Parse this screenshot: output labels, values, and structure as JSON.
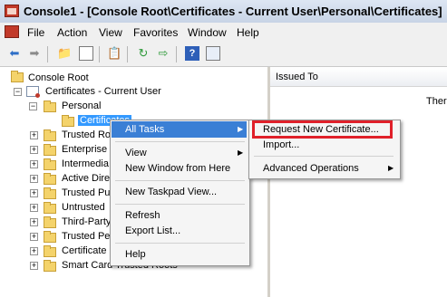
{
  "window": {
    "title": "Console1 - [Console Root\\Certificates - Current User\\Personal\\Certificates]"
  },
  "menubar": {
    "items": [
      "File",
      "Action",
      "View",
      "Favorites",
      "Window",
      "Help"
    ]
  },
  "toolbar": {
    "icons": [
      "back-arrow-icon",
      "forward-arrow-icon",
      "up-folder-icon",
      "show-hide-tree-icon",
      "clipboard-icon",
      "refresh-icon",
      "export-icon",
      "help-icon",
      "properties-icon"
    ]
  },
  "tree": {
    "root": "Console Root",
    "store": "Certificates - Current User",
    "personal": "Personal",
    "certificates": "Certificates",
    "folders": [
      "Trusted Ro",
      "Enterprise",
      "Intermedia",
      "Active Dire",
      "Trusted Pu",
      "Untrusted",
      "Third-Party",
      "Trusted Pe",
      "Certificate",
      "Smart Card Trusted Roots"
    ]
  },
  "list": {
    "column_issued_to": "Issued To",
    "empty_text": "Ther"
  },
  "context_menu": {
    "all_tasks": "All Tasks",
    "view": "View",
    "new_window": "New Window from Here",
    "new_taskpad": "New Taskpad View...",
    "refresh": "Refresh",
    "export_list": "Export List...",
    "help": "Help"
  },
  "submenu": {
    "request_new_certificate": "Request New Certificate...",
    "import": "Import...",
    "advanced_operations": "Advanced Operations"
  },
  "colors": {
    "highlight": "#3a7fd5",
    "annotation_red": "#e0202a"
  }
}
